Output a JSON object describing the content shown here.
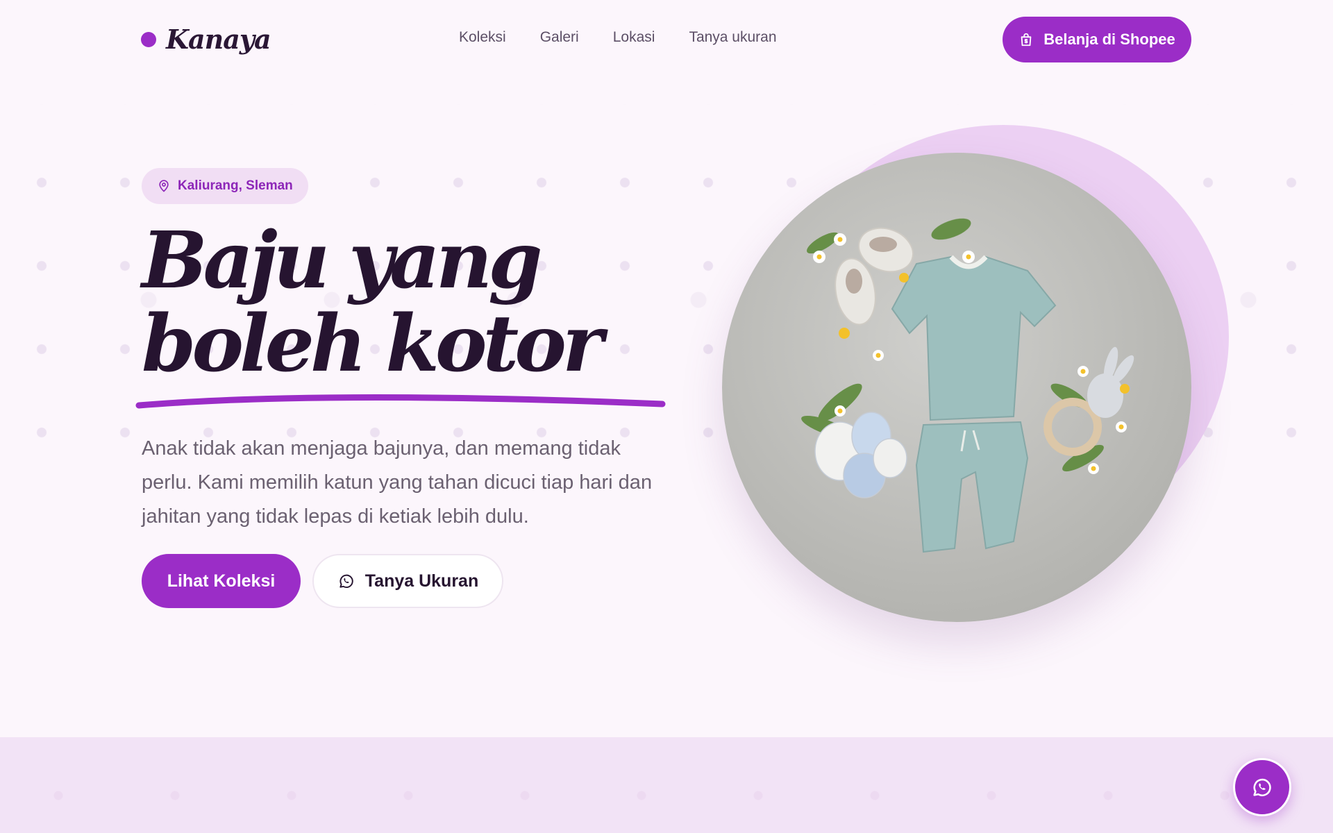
{
  "brand": {
    "name": "Kanaya",
    "accent_color": "#9b2dc7"
  },
  "nav": {
    "items": [
      {
        "label": "Koleksi"
      },
      {
        "label": "Galeri"
      },
      {
        "label": "Lokasi"
      },
      {
        "label": "Tanya ukuran"
      }
    ]
  },
  "header": {
    "shop_button_label": "Belanja di Shopee",
    "shop_icon": "shopping-bag-icon"
  },
  "hero": {
    "location_badge": "Kaliurang, Sleman",
    "location_icon": "map-pin-icon",
    "headline_line1": "Baju yang",
    "headline_line2": "boleh kotor",
    "description": "Anak tidak akan menjaga bajunya, dan memang tidak perlu. Kami memilih katun yang tahan dicuci tiap hari dan jahitan yang tidak lepas di ketiak lebih dulu.",
    "primary_button": "Lihat Koleksi",
    "secondary_button": "Tanya Ukuran",
    "secondary_icon": "whatsapp-icon"
  },
  "floating": {
    "whatsapp_icon": "whatsapp-icon"
  }
}
